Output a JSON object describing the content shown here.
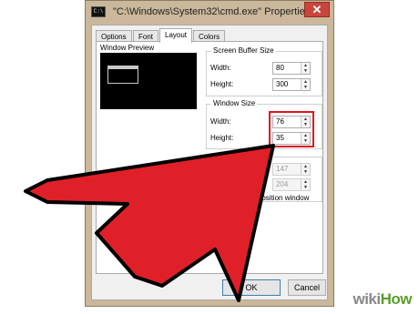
{
  "window": {
    "app_icon_text": "C:\\",
    "title": "\"C:\\Windows\\System32\\cmd.exe\" Properties",
    "close_symbol": "✕"
  },
  "tabs": [
    {
      "label": "Options",
      "active": false
    },
    {
      "label": "Font",
      "active": false
    },
    {
      "label": "Layout",
      "active": true
    },
    {
      "label": "Colors",
      "active": false
    }
  ],
  "preview": {
    "label": "Window Preview"
  },
  "screen_buffer": {
    "title": "Screen Buffer Size",
    "width_label": "Width:",
    "width_value": "80",
    "height_label": "Height:",
    "height_value": "300"
  },
  "window_size": {
    "title": "Window Size",
    "width_label": "Width:",
    "width_value": "76",
    "height_label": "Height:",
    "height_value": "35"
  },
  "window_position": {
    "left_value": "147",
    "top_value": "204",
    "let_system_label": "Let system position window"
  },
  "buttons": {
    "ok": "OK",
    "cancel": "Cancel"
  },
  "spin": {
    "up": "▲",
    "down": "▼"
  },
  "brand": {
    "part1": "wiki",
    "part2": "How"
  },
  "colors": {
    "highlight": "#e2121b",
    "arrow": "#e02028",
    "title_bar": "#cbb79a",
    "close": "#c8463c"
  }
}
